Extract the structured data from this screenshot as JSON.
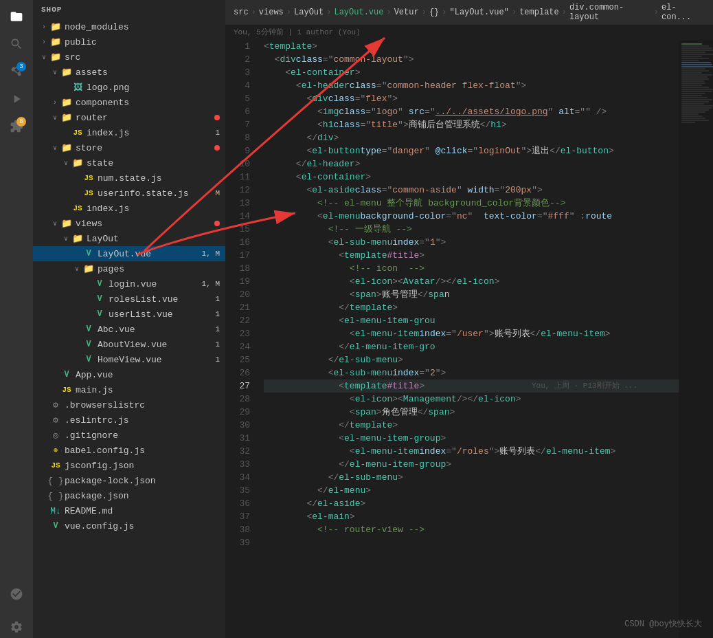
{
  "activityBar": {
    "icons": [
      {
        "name": "files-icon",
        "symbol": "⎘",
        "active": true,
        "badge": null
      },
      {
        "name": "search-icon",
        "symbol": "🔍",
        "active": false,
        "badge": null
      },
      {
        "name": "source-control-icon",
        "symbol": "⎇",
        "active": false,
        "badge": "3"
      },
      {
        "name": "run-icon",
        "symbol": "▶",
        "active": false,
        "badge": null
      },
      {
        "name": "extensions-icon",
        "symbol": "⊞",
        "active": false,
        "badge": "8"
      },
      {
        "name": "git-icon",
        "symbol": "◎",
        "active": false,
        "badge": null
      }
    ]
  },
  "sidebar": {
    "title": "SHOP",
    "tree": [
      {
        "id": "node_modules",
        "label": "node_modules",
        "type": "folder",
        "indent": 1,
        "expanded": false,
        "badge": null
      },
      {
        "id": "public",
        "label": "public",
        "type": "folder",
        "indent": 1,
        "expanded": false,
        "badge": null
      },
      {
        "id": "src",
        "label": "src",
        "type": "folder-src",
        "indent": 1,
        "expanded": true,
        "badge": null
      },
      {
        "id": "assets",
        "label": "assets",
        "type": "folder-assets",
        "indent": 2,
        "expanded": true,
        "badge": null
      },
      {
        "id": "logo",
        "label": "logo.png",
        "type": "image",
        "indent": 3,
        "expanded": false,
        "badge": null
      },
      {
        "id": "components",
        "label": "components",
        "type": "folder-comp",
        "indent": 2,
        "expanded": false,
        "badge": null
      },
      {
        "id": "router",
        "label": "router",
        "type": "folder-router",
        "indent": 2,
        "expanded": true,
        "badge": "dot"
      },
      {
        "id": "index_router",
        "label": "index.js",
        "type": "js",
        "indent": 3,
        "badge": "1"
      },
      {
        "id": "store",
        "label": "store",
        "type": "folder-store",
        "indent": 2,
        "expanded": true,
        "badge": "dot"
      },
      {
        "id": "state",
        "label": "state",
        "type": "folder-state",
        "indent": 3,
        "expanded": true,
        "badge": null
      },
      {
        "id": "num_state",
        "label": "num.state.js",
        "type": "js",
        "indent": 4,
        "badge": null
      },
      {
        "id": "userinfo_state",
        "label": "userinfo.state.js",
        "type": "js",
        "indent": 4,
        "badge": "M"
      },
      {
        "id": "index_store",
        "label": "index.js",
        "type": "js",
        "indent": 3,
        "badge": null
      },
      {
        "id": "views",
        "label": "views",
        "type": "folder-views",
        "indent": 2,
        "expanded": true,
        "badge": "dot"
      },
      {
        "id": "layout",
        "label": "LayOut",
        "type": "folder-layout",
        "indent": 3,
        "expanded": true,
        "badge": null
      },
      {
        "id": "layout_vue",
        "label": "LayOut.vue",
        "type": "vue",
        "indent": 4,
        "badge": "1,M",
        "selected": true
      },
      {
        "id": "pages",
        "label": "pages",
        "type": "folder-pages",
        "indent": 4,
        "expanded": true,
        "badge": null
      },
      {
        "id": "login_vue",
        "label": "login.vue",
        "type": "vue",
        "indent": 5,
        "badge": "1,M"
      },
      {
        "id": "roleslist_vue",
        "label": "rolesList.vue",
        "type": "vue",
        "indent": 5,
        "badge": "1"
      },
      {
        "id": "userlist_vue",
        "label": "userList.vue",
        "type": "vue",
        "indent": 5,
        "badge": "1"
      },
      {
        "id": "abc_vue",
        "label": "Abc.vue",
        "type": "vue",
        "indent": 4,
        "badge": "1"
      },
      {
        "id": "aboutview_vue",
        "label": "AboutView.vue",
        "type": "vue",
        "indent": 4,
        "badge": "1"
      },
      {
        "id": "homeview_vue",
        "label": "HomeView.vue",
        "type": "vue",
        "indent": 4,
        "badge": "1"
      },
      {
        "id": "app_vue",
        "label": "App.vue",
        "type": "vue",
        "indent": 2,
        "badge": null
      },
      {
        "id": "main_js",
        "label": "main.js",
        "type": "js",
        "indent": 2,
        "badge": null
      },
      {
        "id": "browserslistrc",
        "label": ".browserslistrc",
        "type": "config",
        "indent": 1,
        "badge": null
      },
      {
        "id": "eslintrc",
        "label": ".eslintrc.js",
        "type": "js-config",
        "indent": 1,
        "badge": null
      },
      {
        "id": "gitignore",
        "label": ".gitignore",
        "type": "git",
        "indent": 1,
        "badge": null
      },
      {
        "id": "babel",
        "label": "babel.config.js",
        "type": "babel",
        "indent": 1,
        "badge": null
      },
      {
        "id": "jsconfig",
        "label": "jsconfig.json",
        "type": "json",
        "indent": 1,
        "badge": null
      },
      {
        "id": "package_lock",
        "label": "package-lock.json",
        "type": "json",
        "indent": 1,
        "badge": null
      },
      {
        "id": "package",
        "label": "package.json",
        "type": "json",
        "indent": 1,
        "badge": null
      },
      {
        "id": "readme",
        "label": "README.md",
        "type": "md",
        "indent": 1,
        "badge": null
      },
      {
        "id": "vue_config",
        "label": "vue.config.js",
        "type": "vue-config",
        "indent": 1,
        "badge": null
      }
    ]
  },
  "breadcrumb": {
    "path": [
      "src",
      "views",
      "LayOut",
      "LayOut.vue",
      "Vetur",
      "{}",
      "\"LayOut.vue\"",
      "template",
      "div.common-layout",
      "el-con..."
    ]
  },
  "meta": {
    "text": "You, 5分钟前 | 1 author (You)"
  },
  "code": {
    "lines": [
      {
        "n": 1,
        "content": "<template>"
      },
      {
        "n": 2,
        "content": "  <div class=\"common-layout\">"
      },
      {
        "n": 3,
        "content": "    <el-container>"
      },
      {
        "n": 4,
        "content": "      <el-header class=\"common-header flex-float\">"
      },
      {
        "n": 5,
        "content": "        <div class=\"flex\">"
      },
      {
        "n": 6,
        "content": "          <img class=\"logo\" src=\"../../assets/logo.png\" alt=\"\" />"
      },
      {
        "n": 7,
        "content": "          <h1 class=\"title\">商铺后台管理系统</h1>"
      },
      {
        "n": 8,
        "content": "        </div>"
      },
      {
        "n": 9,
        "content": "        <el-button type=\"danger\" @click=\"loginOut\">退出</el-button>"
      },
      {
        "n": 10,
        "content": "      </el-header>"
      },
      {
        "n": 11,
        "content": "      <el-container>"
      },
      {
        "n": 12,
        "content": "        <el-aside class=\"common-aside\" width=\"200px\">"
      },
      {
        "n": 13,
        "content": "          <!-- el-menu 整个导航 background_color背景颜色-->"
      },
      {
        "n": 14,
        "content": "          <el-menu background-color=\"nc\" text-color=\"#fff\" :route"
      },
      {
        "n": 15,
        "content": "            <!-- 一级导航 -->"
      },
      {
        "n": 16,
        "content": "            <el-sub-menu index=\"1\">"
      },
      {
        "n": 17,
        "content": "              <template #title>"
      },
      {
        "n": 18,
        "content": "                <!-- icon  -->"
      },
      {
        "n": 19,
        "content": "                <el-icon><Avatar /></el-icon>"
      },
      {
        "n": 20,
        "content": "                <span>账号管理</span>"
      },
      {
        "n": 21,
        "content": "              </template>"
      },
      {
        "n": 22,
        "content": "              <el-menu-item-grou"
      },
      {
        "n": 23,
        "content": "                <el-menu-item index=\"/user\">账号列表</el-menu-item>"
      },
      {
        "n": 24,
        "content": "              </el-menu-item-gro"
      },
      {
        "n": 25,
        "content": "            </el-sub-menu>"
      },
      {
        "n": 26,
        "content": "            <el-sub-menu index=\"2\">"
      },
      {
        "n": 27,
        "content": "              <template #title>",
        "blame": "You, 上周 · P13刚开始 ..."
      },
      {
        "n": 28,
        "content": "                <el-icon><Management /></el-icon>"
      },
      {
        "n": 29,
        "content": "                <span>角色管理</span>"
      },
      {
        "n": 30,
        "content": "              </template>"
      },
      {
        "n": 31,
        "content": "              <el-menu-item-group>"
      },
      {
        "n": 32,
        "content": "                <el-menu-item index=\"/roles\">账号列表</el-menu-item>"
      },
      {
        "n": 33,
        "content": "              </el-menu-item-group>"
      },
      {
        "n": 34,
        "content": "            </el-sub-menu>"
      },
      {
        "n": 35,
        "content": "          </el-menu>"
      },
      {
        "n": 36,
        "content": "        </el-aside>"
      },
      {
        "n": 37,
        "content": "        <el-main>"
      },
      {
        "n": 38,
        "content": "          <!-- router-view -->"
      },
      {
        "n": 39,
        "content": ""
      }
    ]
  },
  "watermark": "CSDN @boy快快长大"
}
